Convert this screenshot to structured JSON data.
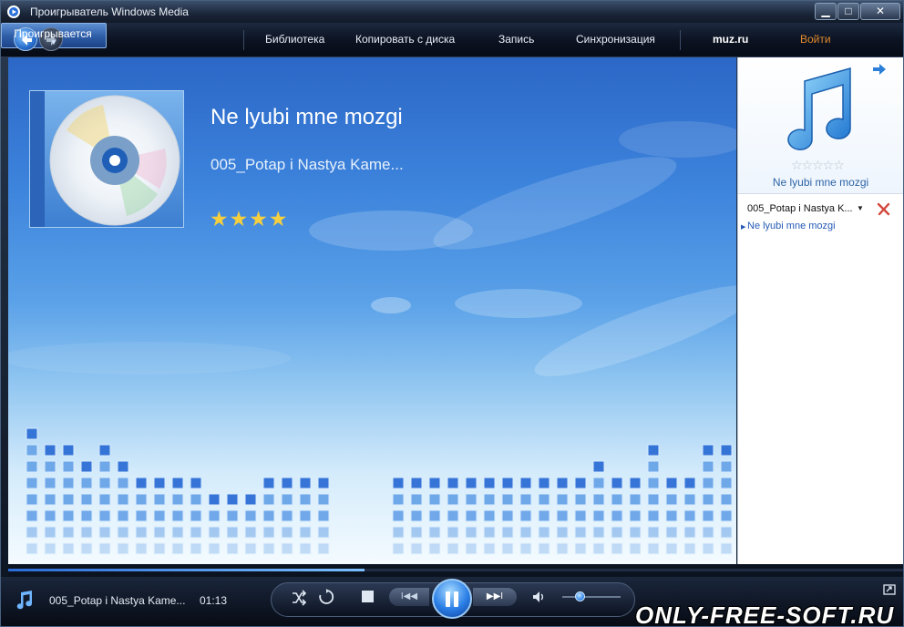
{
  "window": {
    "title": "Проигрыватель Windows Media",
    "min_label": "▁",
    "max_label": "□",
    "close_label": "✕"
  },
  "nav": {
    "tabs": [
      {
        "label": "Проигрывается",
        "active": true
      },
      {
        "label": "Библиотека"
      },
      {
        "label": "Копировать с диска"
      },
      {
        "label": "Запись"
      },
      {
        "label": "Синхронизация"
      }
    ],
    "store": "muz.ru",
    "login": "Войти"
  },
  "now_playing": {
    "title": "Ne lyubi mne mozgi",
    "artist": "005_Potap i  Nastya Kame...",
    "rating_stars": "★★★★"
  },
  "list_pane": {
    "empty_rating": "☆☆☆☆☆",
    "album_title": "Ne lyubi mne mozgi",
    "playlist_name": "005_Potap i Nastya K...",
    "playlist_items": [
      "Ne lyubi mne mozgi"
    ]
  },
  "transport": {
    "track": "005_Potap i Nastya Kame...",
    "elapsed": "01:13",
    "seek_fraction": 0.398,
    "volume_fraction": 0.3,
    "prev_label": "I◀◀",
    "next_label": "▶▶I",
    "watermark": "ONLY-FREE-SOFT.RU"
  },
  "icons": {
    "app": "wmp-icon",
    "back": "back-arrow-icon",
    "forward": "forward-arrow-icon",
    "note": "music-note-icon",
    "clear": "clear-list-icon"
  },
  "colors": {
    "accent": "#2a7ee6",
    "link": "#2459b4",
    "login": "#e08a2c",
    "rating": "#f5cf3e"
  }
}
